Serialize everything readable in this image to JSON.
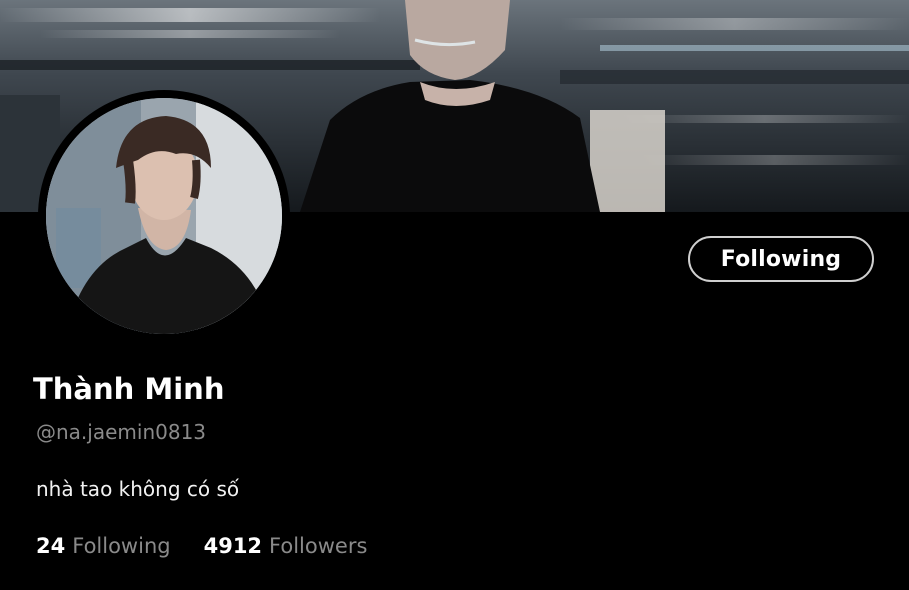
{
  "profile": {
    "display_name": "Thành Minh",
    "handle": "@na.jaemin0813",
    "bio": "nhà tao không có số",
    "follow_button_label": "Following"
  },
  "stats": {
    "following_count": "24",
    "following_label": "Following",
    "followers_count": "4912",
    "followers_label": "Followers"
  },
  "colors": {
    "background": "#000000",
    "primary_text": "#ffffff",
    "secondary_text": "#8a8a8a",
    "button_border": "#cfcfcf"
  }
}
